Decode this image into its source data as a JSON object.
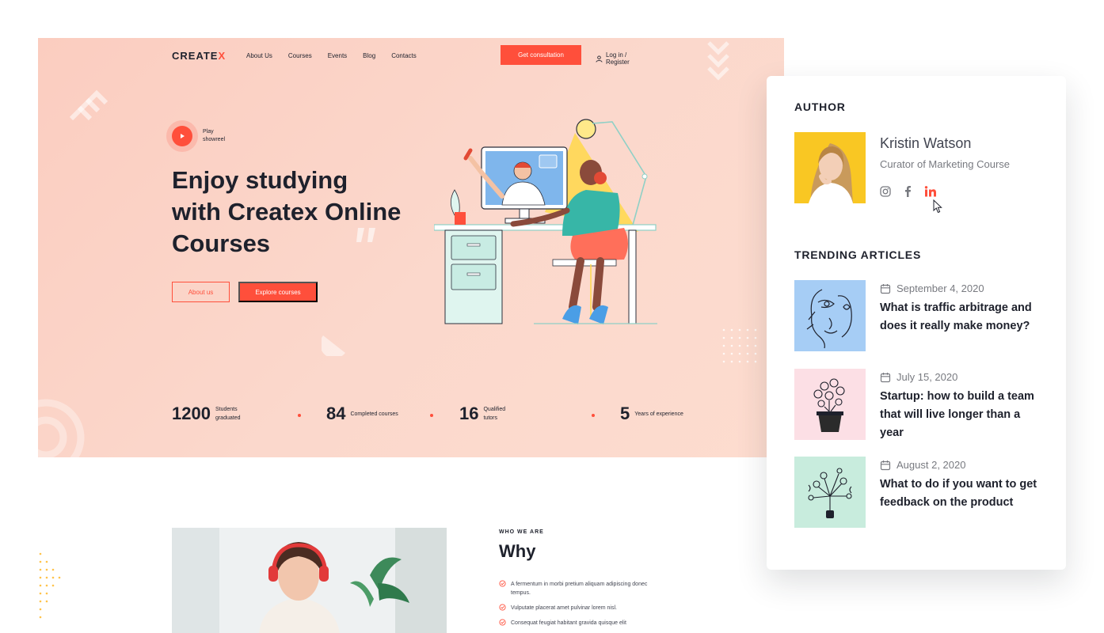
{
  "colors": {
    "accent": "#ff4f3b",
    "dark": "#1e212c",
    "muted": "#787a80",
    "hero_bg": "#fbd3c6"
  },
  "brand": {
    "name": "CREATE",
    "mark": "X"
  },
  "nav": {
    "links": [
      "About Us",
      "Courses",
      "Events",
      "Blog",
      "Contacts"
    ],
    "cta": "Get consultation",
    "login": "Log in / Register",
    "login_icon": "user-icon"
  },
  "hero": {
    "showreel": "Play showreel",
    "title": "Enjoy studying with Createx Online Courses",
    "btn_about": "About us",
    "btn_explore": "Explore courses"
  },
  "stats": [
    {
      "value": "1200",
      "label": "Students graduated"
    },
    {
      "value": "84",
      "label": "Completed courses"
    },
    {
      "value": "16",
      "label": "Qualified tutors"
    },
    {
      "value": "5",
      "label": "Years of experience"
    }
  ],
  "about": {
    "eyebrow": "WHO WE ARE",
    "title": "Why",
    "points": [
      "A fermentum in morbi pretium aliquam adipiscing donec tempus.",
      "Vulputate placerat amet pulvinar lorem nisl.",
      "Consequat feugiat habitant gravida quisque elit"
    ]
  },
  "sidebar": {
    "author_heading": "AUTHOR",
    "author": {
      "name": "Kristin Watson",
      "role": "Curator of Marketing Course",
      "socials": [
        "instagram-icon",
        "facebook-icon",
        "linkedin-icon"
      ],
      "active_social": "linkedin-icon"
    },
    "trending_heading": "TRENDING ARTICLES",
    "articles": [
      {
        "date": "September 4, 2020",
        "title": "What is traffic arbitrage and does it really make money?",
        "thumb_color": "#a6cdf5"
      },
      {
        "date": "July 15, 2020",
        "title": "Startup: how to build a team that will live longer than a year",
        "thumb_color": "#fcdfe5"
      },
      {
        "date": "August 2, 2020",
        "title": "What to do if you want to get feedback on the product",
        "thumb_color": "#c8ecdd"
      }
    ]
  }
}
